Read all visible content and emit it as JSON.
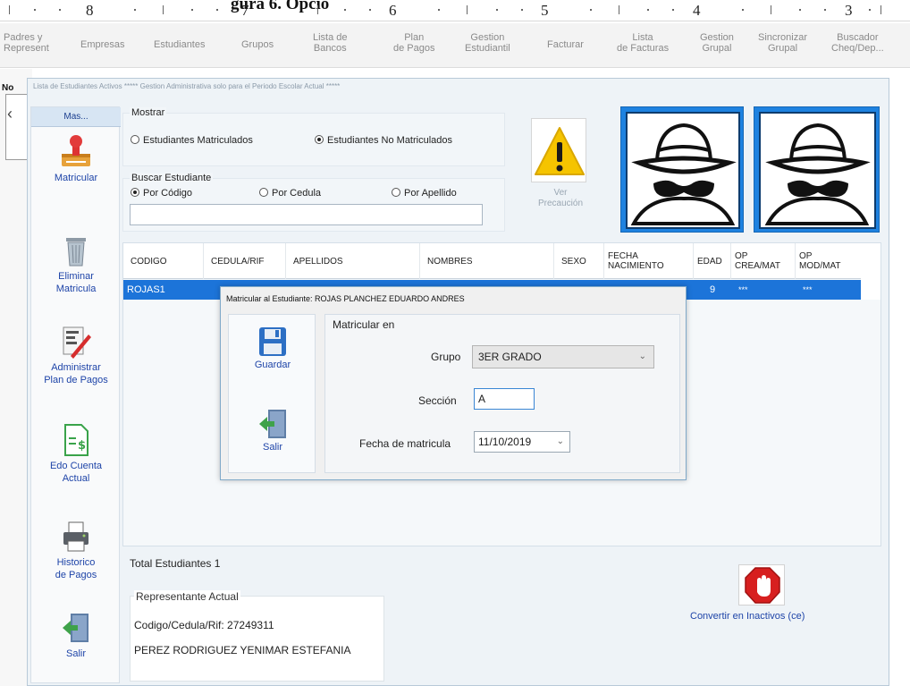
{
  "ruler": {
    "title": "gura 6. Opcio",
    "numbers": [
      "8",
      "7",
      "6",
      "5",
      "4",
      "3"
    ]
  },
  "top_menu": [
    "Padres y\nRepresent",
    "Empresas",
    "Estudiantes",
    "Grupos",
    "Lista de\nBancos",
    "Plan\nde Pagos",
    "Gestion\nEstudiantil",
    "Facturar",
    "Lista\nde Facturas",
    "Gestion\nGrupal",
    "Sincronizar\nGrupal",
    "Buscador\nCheq/Dep..."
  ],
  "parent_label": "No",
  "main_window": {
    "title": "Lista de Estudiantes Activos      ***** Gestion Administrativa solo para el Periodo Escolar Actual *****"
  },
  "toolbar": {
    "tab": "Mas...",
    "items": [
      {
        "label": "Matricular",
        "icon": "enroll-stamp-icon"
      },
      {
        "label": "Eliminar\nMatricula",
        "icon": "trash-icon"
      },
      {
        "label": "Administrar\nPlan de Pagos",
        "icon": "edit-plan-icon"
      },
      {
        "label": "Edo Cuenta\nActual",
        "icon": "account-statement-icon"
      },
      {
        "label": "Historico\nde Pagos",
        "icon": "printer-icon"
      },
      {
        "label": "Salir",
        "icon": "exit-door-icon"
      }
    ]
  },
  "show": {
    "label": "Mostrar",
    "options": [
      {
        "label": "Estudiantes Matriculados",
        "checked": false
      },
      {
        "label": "Estudiantes No Matriculados",
        "checked": true
      }
    ]
  },
  "search": {
    "label": "Buscar Estudiante",
    "options": [
      {
        "label": "Por Código",
        "checked": true
      },
      {
        "label": "Por Cedula",
        "checked": false
      },
      {
        "label": "Por Apellido",
        "checked": false
      }
    ],
    "value": ""
  },
  "warning": {
    "label": "Ver\nPrecaución",
    "icon": "warning-icon"
  },
  "avatars": [
    "spy-avatar-icon",
    "spy-avatar-icon"
  ],
  "grid": {
    "columns": [
      "CODIGO",
      "CEDULA/RIF",
      "APELLIDOS",
      "NOMBRES",
      "SEXO",
      "FECHA\nNACIMIENTO",
      "EDAD",
      "OP\nCREA/MAT",
      "OP\nMOD/MAT"
    ],
    "rows": [
      [
        "ROJAS1",
        "",
        "",
        "",
        "",
        "",
        "9",
        "***",
        "***"
      ]
    ]
  },
  "total": "Total Estudiantes 1",
  "representative": {
    "label": "Representante Actual",
    "id_line": "Codigo/Cedula/Rif:  27249311",
    "name": "PEREZ RODRIGUEZ YENIMAR ESTEFANIA"
  },
  "inactive": {
    "label": "Convertir en Inactivos (ce)",
    "icon": "stop-hand-icon"
  },
  "dialog": {
    "title": "Matricular al Estudiante: ROJAS PLANCHEZ EDUARDO ANDRES",
    "save_label": "Guardar",
    "exit_label": "Salir",
    "section_label": "Matricular en",
    "group_label": "Grupo",
    "group_value": "3ER GRADO",
    "section_field_label": "Sección",
    "section_value": "A",
    "date_label": "Fecha de matricula",
    "date_value": "11/10/2019"
  },
  "colors": {
    "selection": "#1c74d9",
    "link": "#1e44a8",
    "avatar_bg": "#1e82e0",
    "warning": "#f5c400",
    "stop": "#d71f1f"
  }
}
